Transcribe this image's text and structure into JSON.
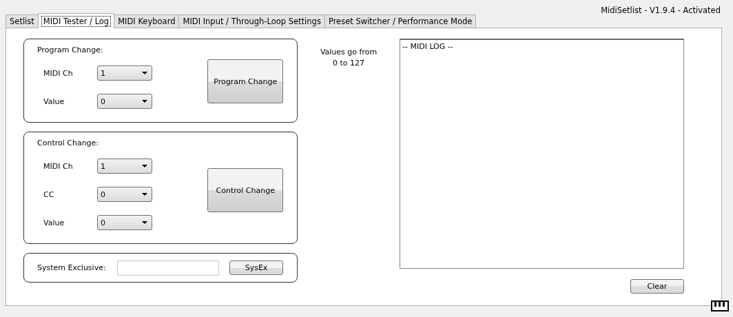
{
  "window": {
    "title": "MidiSetlist - V1.9.4 - Activated"
  },
  "tabs": [
    {
      "label": "Setlist",
      "selected": false
    },
    {
      "label": "MIDI Tester / Log",
      "selected": true
    },
    {
      "label": "MIDI Keyboard",
      "selected": false
    },
    {
      "label": "MIDI Input / Through-Loop Settings",
      "selected": false
    },
    {
      "label": "Preset Switcher / Performance Mode",
      "selected": false
    }
  ],
  "groups": [
    {
      "title": "Program Change:",
      "fields": [
        {
          "label": "MIDI Ch",
          "value": "1"
        },
        {
          "label": "Value",
          "value": "0"
        }
      ],
      "button": "Program Change"
    },
    {
      "title": "Control Change:",
      "fields": [
        {
          "label": "MIDI Ch",
          "value": "1"
        },
        {
          "label": "CC",
          "value": "0"
        },
        {
          "label": "Value",
          "value": "0"
        }
      ],
      "button": "Control Change"
    }
  ],
  "sysex": {
    "label": "System Exclusive:",
    "button": "SysEx"
  },
  "hint": [
    "Values go from",
    "0 to 127"
  ],
  "log": {
    "text": "-- MIDI LOG --"
  },
  "clear_button": "Clear"
}
